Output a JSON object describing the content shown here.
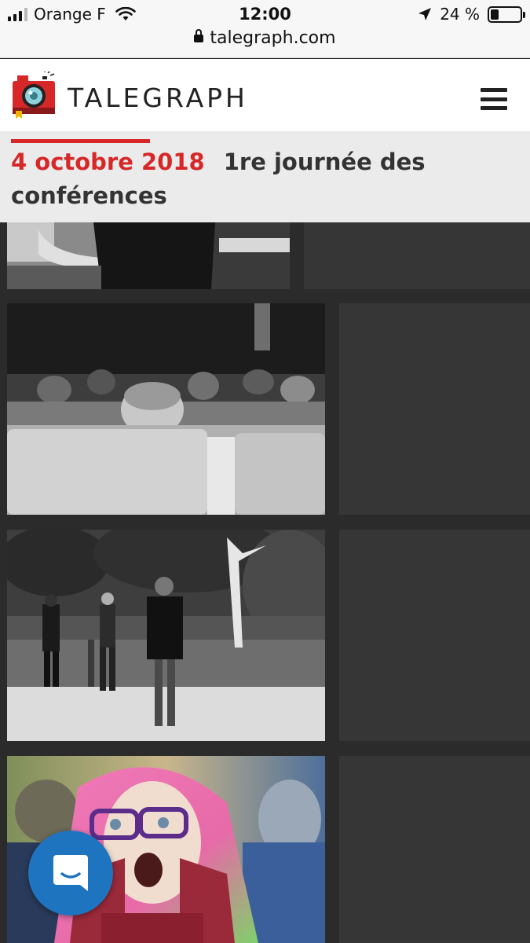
{
  "status_bar": {
    "carrier": "Orange F",
    "time": "12:00",
    "battery_percent": "24 %",
    "battery_level": 0.24
  },
  "browser": {
    "url": "talegraph.com"
  },
  "header": {
    "brand": "TALEGRAPH",
    "logo_icon": "camera-logo-icon",
    "menu_icon": "hamburger-menu-icon"
  },
  "page": {
    "date": "4 octobre 2018",
    "title": "1re journée des conférences"
  },
  "colors": {
    "accent_red": "#d62828",
    "chat_blue": "#1f74c0",
    "gallery_bg": "#2b2b2b"
  },
  "gallery": {
    "photos": [
      {
        "subject": "man-arm-partial-photo"
      },
      {
        "subject": "audience-man-peeking-photo"
      },
      {
        "subject": "three-people-outdoors-photo"
      },
      {
        "subject": "pink-hair-woman-glasses-photo"
      }
    ]
  },
  "chat_widget": {
    "icon": "chat-bubble-icon"
  }
}
